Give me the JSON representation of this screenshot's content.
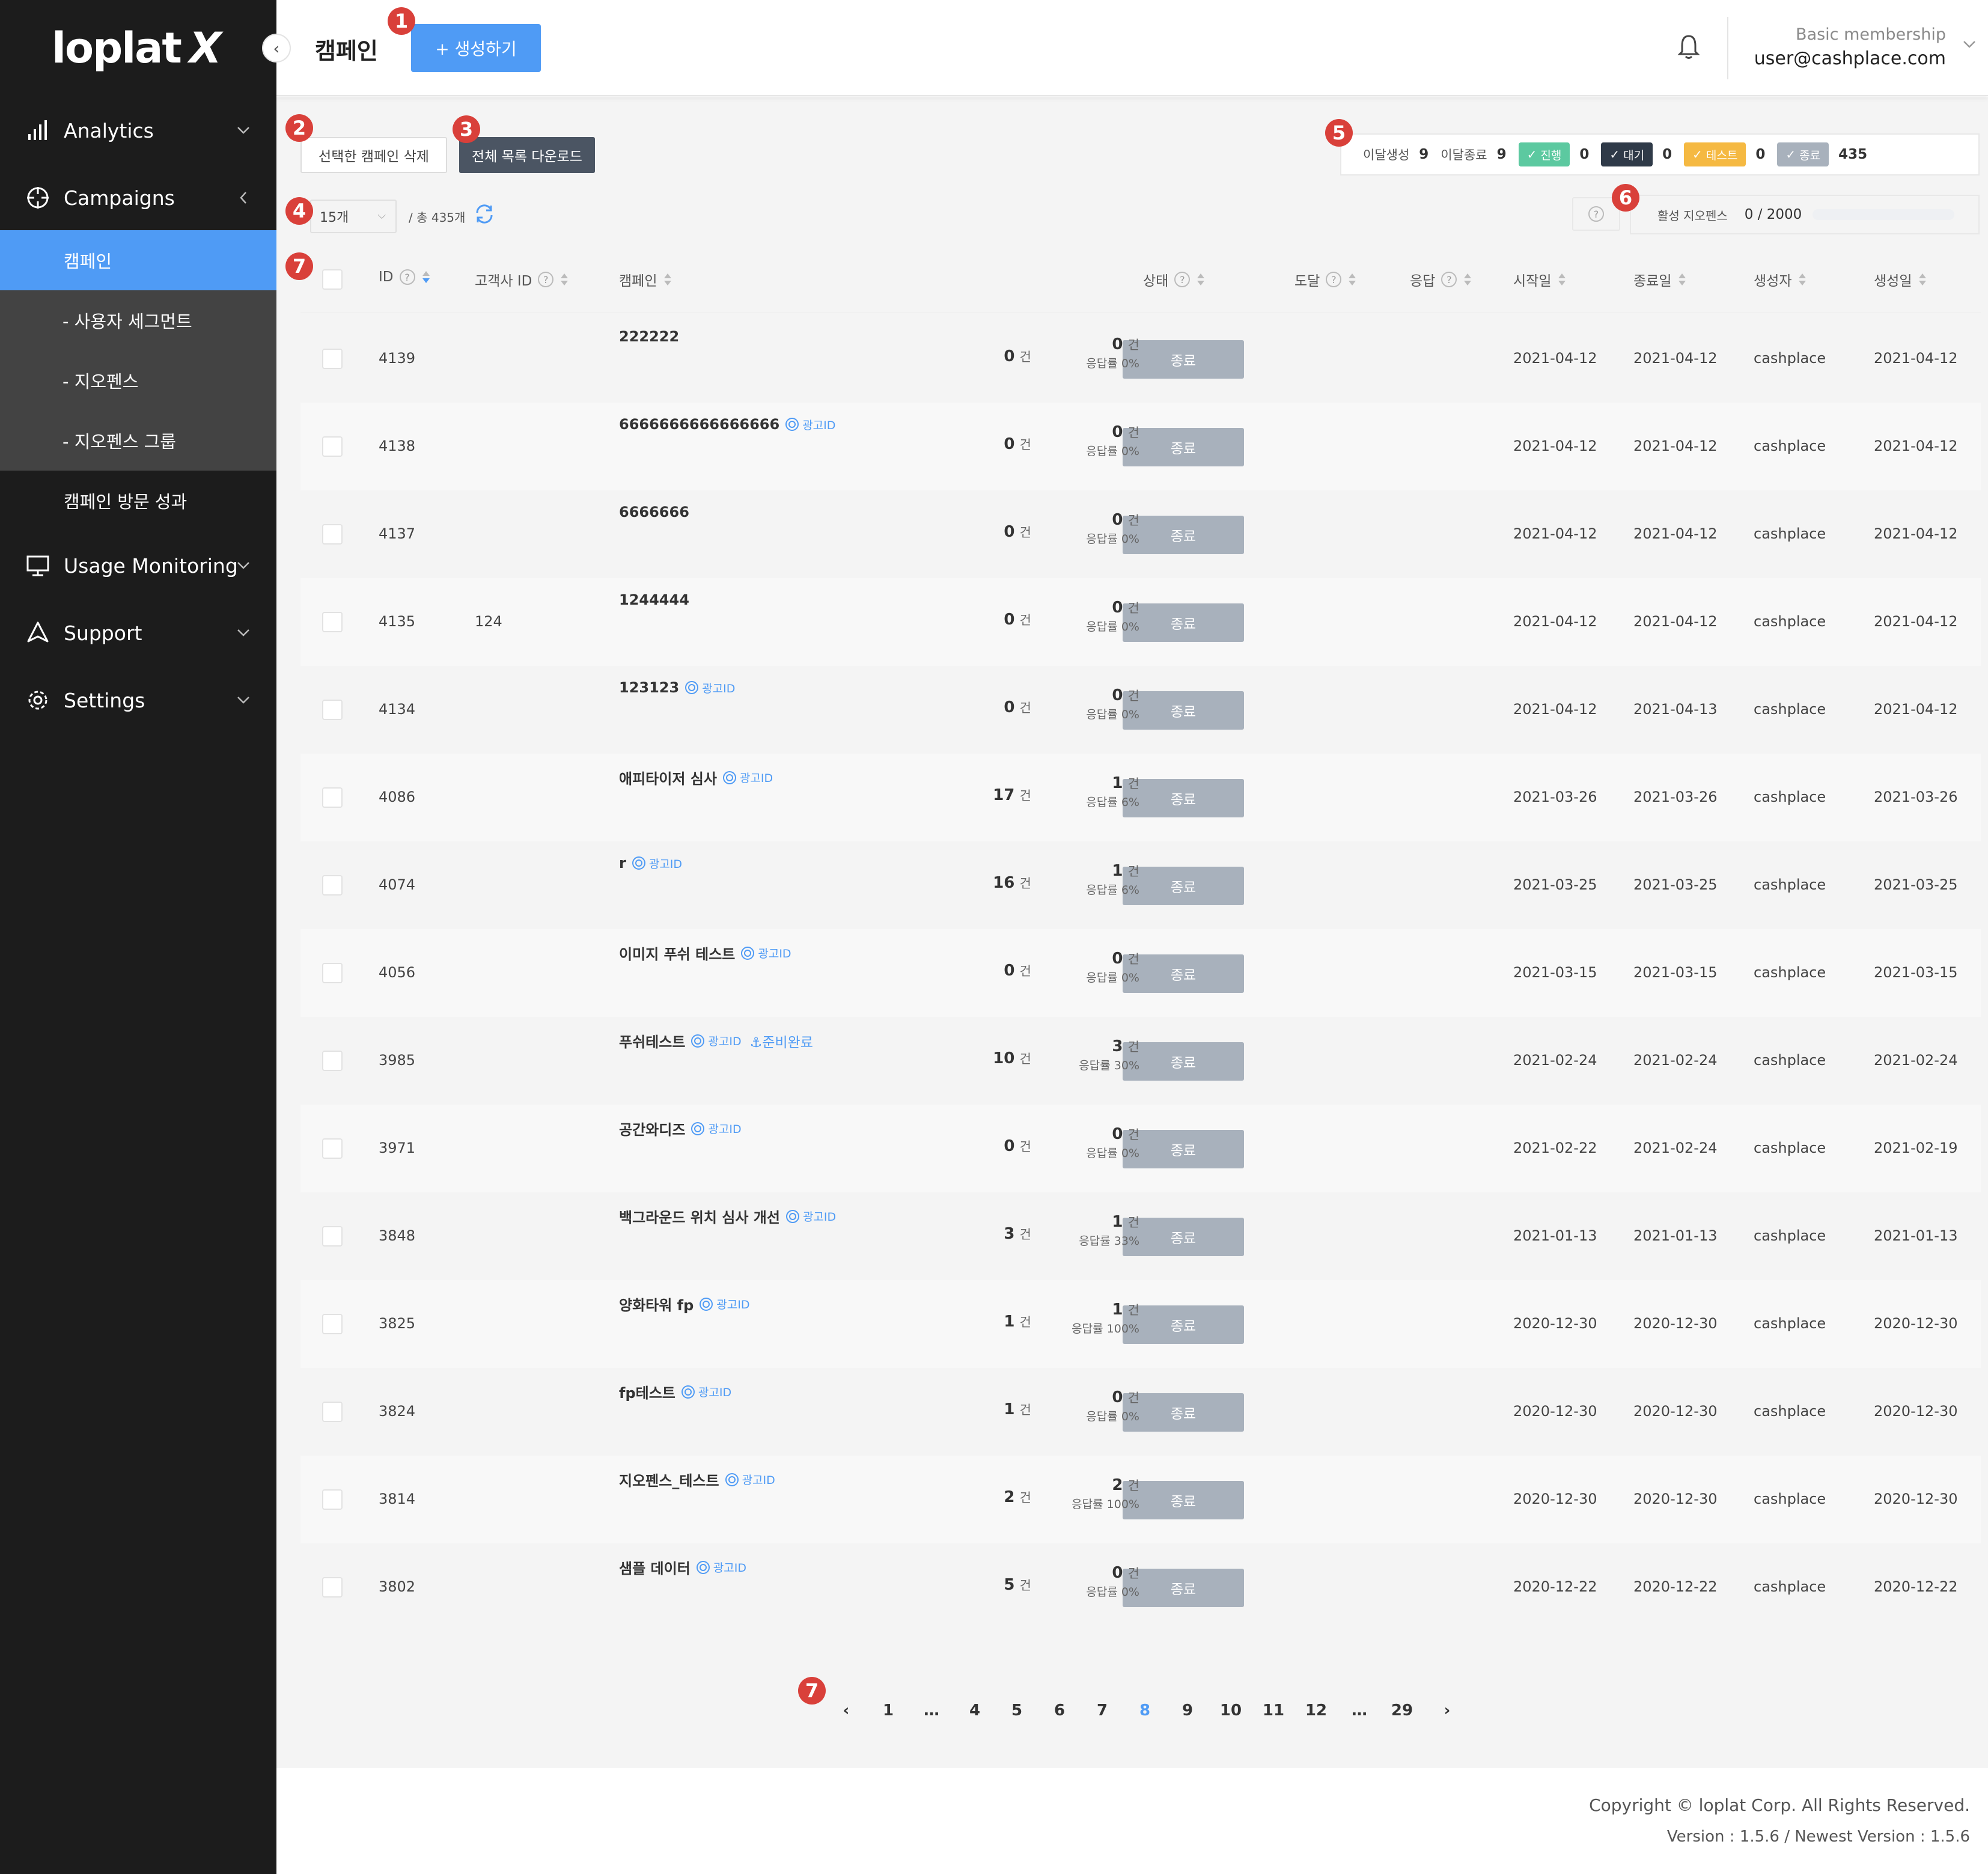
{
  "sidebar": {
    "logo": "loplat",
    "logo_x": "X",
    "items": [
      {
        "label": "Analytics",
        "icon": "bar-chart-icon"
      },
      {
        "label": "Campaigns",
        "icon": "crosshair-icon"
      },
      {
        "label": "Usage Monitoring",
        "icon": "monitor-icon"
      },
      {
        "label": "Support",
        "icon": "send-icon"
      },
      {
        "label": "Settings",
        "icon": "gear-icon"
      }
    ],
    "sub_items": [
      {
        "label": "캠페인"
      },
      {
        "label": "- 사용자 세그먼트"
      },
      {
        "label": "- 지오펜스"
      },
      {
        "label": "- 지오펜스 그룹"
      },
      {
        "label": "캠페인 방문 성과"
      }
    ]
  },
  "header": {
    "title": "캠페인",
    "create_label": "+ 생성하기",
    "membership": "Basic membership",
    "email": "user@cashplace.com"
  },
  "badges": [
    "1",
    "2",
    "3",
    "4",
    "5",
    "6",
    "7",
    "7"
  ],
  "toolbar": {
    "delete_label": "선택한 캠페인 삭제",
    "download_label": "전체 목록 다운로드",
    "page_size": "15개",
    "total": "/ 총 435개"
  },
  "stats": {
    "created_label": "이달생성",
    "created": "9",
    "ended_label": "이달종료",
    "ended": "9",
    "running_label": "진행",
    "running": "0",
    "waiting_label": "대기",
    "waiting": "0",
    "test_label": "테스트",
    "test": "0",
    "done_label": "종료",
    "done": "435",
    "colors": {
      "running": "#5cc9a0",
      "waiting": "#2f3a48",
      "test": "#f5b942",
      "done": "#a8b1bc"
    }
  },
  "geofence": {
    "label": "활성 지오펜스",
    "value": "0 / 2000",
    "usage_fraction": 0
  },
  "table": {
    "headers": {
      "id": "ID",
      "client_id": "고객사 ID",
      "campaign": "캠페인",
      "status": "상태",
      "reach": "도달",
      "response": "응답",
      "start": "시작일",
      "end": "종료일",
      "creator": "생성자",
      "created": "생성일"
    },
    "status_label": "종료",
    "unit": "건",
    "rate_label": "응답률",
    "adid_label": "광고ID",
    "rows": [
      {
        "id": "4139",
        "client": "",
        "name": "222222",
        "adid": false,
        "ready": "",
        "reach": "0",
        "resp": "0",
        "rate": "0%",
        "start": "2021-04-12",
        "end": "2021-04-12",
        "creator": "cashplace",
        "created": "2021-04-12"
      },
      {
        "id": "4138",
        "client": "",
        "name": "6666666666666666",
        "adid": true,
        "ready": "",
        "reach": "0",
        "resp": "0",
        "rate": "0%",
        "start": "2021-04-12",
        "end": "2021-04-12",
        "creator": "cashplace",
        "created": "2021-04-12"
      },
      {
        "id": "4137",
        "client": "",
        "name": "6666666",
        "adid": false,
        "ready": "",
        "reach": "0",
        "resp": "0",
        "rate": "0%",
        "start": "2021-04-12",
        "end": "2021-04-12",
        "creator": "cashplace",
        "created": "2021-04-12"
      },
      {
        "id": "4135",
        "client": "124",
        "name": "1244444",
        "adid": false,
        "ready": "",
        "reach": "0",
        "resp": "0",
        "rate": "0%",
        "start": "2021-04-12",
        "end": "2021-04-12",
        "creator": "cashplace",
        "created": "2021-04-12"
      },
      {
        "id": "4134",
        "client": "",
        "name": "123123",
        "adid": true,
        "ready": "",
        "reach": "0",
        "resp": "0",
        "rate": "0%",
        "start": "2021-04-12",
        "end": "2021-04-13",
        "creator": "cashplace",
        "created": "2021-04-12"
      },
      {
        "id": "4086",
        "client": "",
        "name": "애피타이저 심사",
        "adid": true,
        "ready": "",
        "reach": "17",
        "resp": "1",
        "rate": "6%",
        "start": "2021-03-26",
        "end": "2021-03-26",
        "creator": "cashplace",
        "created": "2021-03-26"
      },
      {
        "id": "4074",
        "client": "",
        "name": "r",
        "adid": true,
        "ready": "",
        "reach": "16",
        "resp": "1",
        "rate": "6%",
        "start": "2021-03-25",
        "end": "2021-03-25",
        "creator": "cashplace",
        "created": "2021-03-25"
      },
      {
        "id": "4056",
        "client": "",
        "name": "이미지 푸쉬 테스트",
        "adid": true,
        "ready": "",
        "reach": "0",
        "resp": "0",
        "rate": "0%",
        "start": "2021-03-15",
        "end": "2021-03-15",
        "creator": "cashplace",
        "created": "2021-03-15"
      },
      {
        "id": "3985",
        "client": "",
        "name": "푸쉬테스트",
        "adid": true,
        "ready": "⚓준비완료",
        "reach": "10",
        "resp": "3",
        "rate": "30%",
        "start": "2021-02-24",
        "end": "2021-02-24",
        "creator": "cashplace",
        "created": "2021-02-24"
      },
      {
        "id": "3971",
        "client": "",
        "name": "공간와디즈",
        "adid": true,
        "ready": "",
        "reach": "0",
        "resp": "0",
        "rate": "0%",
        "start": "2021-02-22",
        "end": "2021-02-24",
        "creator": "cashplace",
        "created": "2021-02-19"
      },
      {
        "id": "3848",
        "client": "",
        "name": "백그라운드 위치 심사 개선",
        "adid": true,
        "ready": "",
        "reach": "3",
        "resp": "1",
        "rate": "33%",
        "start": "2021-01-13",
        "end": "2021-01-13",
        "creator": "cashplace",
        "created": "2021-01-13"
      },
      {
        "id": "3825",
        "client": "",
        "name": "양화타워 fp",
        "adid": true,
        "ready": "",
        "reach": "1",
        "resp": "1",
        "rate": "100%",
        "start": "2020-12-30",
        "end": "2020-12-30",
        "creator": "cashplace",
        "created": "2020-12-30"
      },
      {
        "id": "3824",
        "client": "",
        "name": "fp테스트",
        "adid": true,
        "ready": "",
        "reach": "1",
        "resp": "0",
        "rate": "0%",
        "start": "2020-12-30",
        "end": "2020-12-30",
        "creator": "cashplace",
        "created": "2020-12-30"
      },
      {
        "id": "3814",
        "client": "",
        "name": "지오펜스_테스트",
        "adid": true,
        "ready": "",
        "reach": "2",
        "resp": "2",
        "rate": "100%",
        "start": "2020-12-30",
        "end": "2020-12-30",
        "creator": "cashplace",
        "created": "2020-12-30"
      },
      {
        "id": "3802",
        "client": "",
        "name": "샘플 데이터",
        "adid": true,
        "ready": "",
        "reach": "5",
        "resp": "0",
        "rate": "0%",
        "start": "2020-12-22",
        "end": "2020-12-22",
        "creator": "cashplace",
        "created": "2020-12-22"
      }
    ]
  },
  "pagination": {
    "pages": [
      "1",
      "…",
      "4",
      "5",
      "6",
      "7",
      "8",
      "9",
      "10",
      "11",
      "12",
      "…",
      "29"
    ],
    "current": "8"
  },
  "footer": {
    "copyright": "Copyright © loplat Corp. All Rights Reserved.",
    "version": "Version : 1.5.6 / Newest Version : 1.5.6"
  },
  "colors": {
    "accent": "#4f9bf5",
    "sidebar": "#1c1c1c",
    "badge": "#d9403a"
  }
}
